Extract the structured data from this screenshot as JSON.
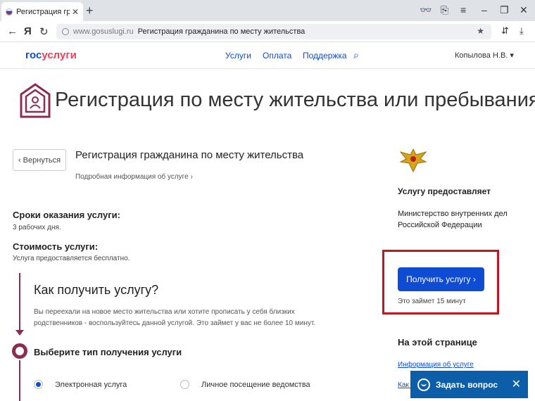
{
  "browser": {
    "tab_title": "Регистрация граждани",
    "tab_close": "✕",
    "new_tab": "+",
    "controls": [
      "👓",
      "⎘",
      "≡",
      "–",
      "❐",
      "✕"
    ],
    "nav": [
      "←",
      "Я",
      "↻"
    ],
    "url_domain": "www.gosuslugi.ru",
    "url_title": "Регистрация гражданина по месту жительства",
    "bookmark": "★",
    "right_icons": [
      "⇵",
      "⤓"
    ]
  },
  "site": {
    "logo_a": "гос",
    "logo_b": "услуги",
    "menu": [
      "Услуги",
      "Оплата",
      "Поддержка"
    ],
    "search_icon": "⌕",
    "user": "Копылова Н.В. ▾"
  },
  "page": {
    "title": "Регистрация по месту жительства или пребывания",
    "back": "‹  Вернуться",
    "service_title": "Регистрация гражданина по месту жительства",
    "service_more": "Подробная информация об услуге  ›",
    "terms_label": "Сроки оказания услуги:",
    "terms_value": "3 рабочих дня.",
    "cost_label": "Стоимость услуги:",
    "cost_value": "Услуга предоставляется бесплатно.",
    "how_title": "Как получить услугу?",
    "how_text": "Вы переехали на новое место жительства или хотите прописать у себя близких родственников - воспользуйтесь данной услугой. Это займет у вас не более 10 минут.",
    "choose_title": "Выберите тип получения услуги",
    "options": [
      {
        "label": "Электронная услуга",
        "selected": true
      },
      {
        "label": "Личное посещение ведомства",
        "selected": false
      }
    ]
  },
  "sidebar": {
    "provider_label": "Услугу предоставляет",
    "provider": "Министерство внутренних дел Российской Федерации",
    "get_button": "Получить услугу  ›",
    "time_note": "Это займет 15 минут",
    "on_page_label": "На этой странице",
    "link1": "Информация об услуге",
    "link2": "Как п"
  },
  "ask": {
    "label": "Задать вопрос",
    "close": "✕"
  },
  "colors": {
    "brand_blue": "#0d4cd3",
    "accent_maroon": "#8c2d4e",
    "highlight_red": "#c0161f"
  }
}
